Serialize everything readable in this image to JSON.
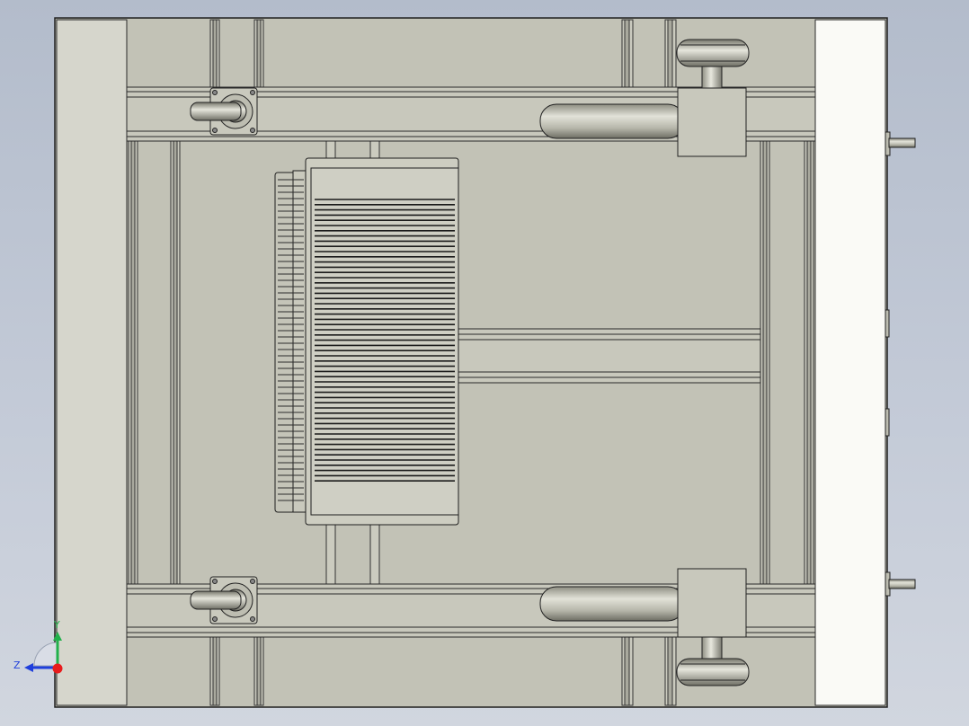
{
  "viewport": {
    "background_top": "#b3bccb",
    "background_bottom": "#d1d6df",
    "model_fill": "#c2c2b6",
    "edge_color": "#1f1f1f"
  },
  "triad": {
    "y_label": "Y",
    "z_label": "Z",
    "y_color": "#22b14c",
    "z_color": "#1f3fdc",
    "x_color": "#e81c1c"
  }
}
